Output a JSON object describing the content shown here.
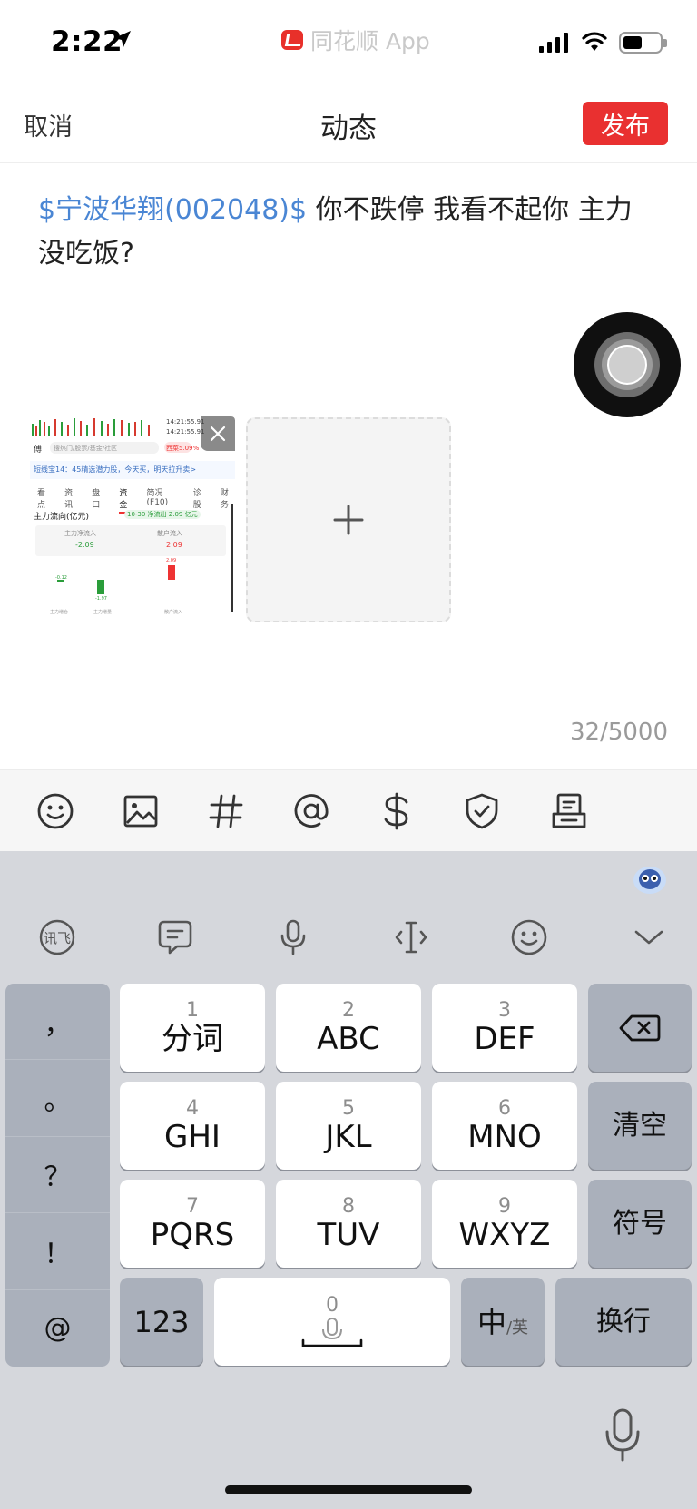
{
  "status_bar": {
    "time": "2:22",
    "app_name": "同花顺 App"
  },
  "nav": {
    "cancel_label": "取消",
    "title": "动态",
    "publish_label": "发布"
  },
  "post": {
    "stock_tag": "$宁波华翔(002048)$",
    "text": " 你不跌停 我看不起你 主力没吃饭?",
    "char_count": "32/5000"
  },
  "attachment": {
    "time_1": "14:21:55.91",
    "time_2": "14:21:55.91",
    "search_placeholder": "搜热门/股票/基金/社区",
    "tag_red": "西菜5.09%",
    "banner": "短线宝14：45精选潜力股，今天买，明天拉升卖>",
    "tabs": [
      "看点",
      "资讯",
      "盘口",
      "资金",
      "简况(F10)",
      "诊股",
      "财务"
    ],
    "active_tab": "资金",
    "flow_title": "主力流向(亿元)",
    "flow_chip": "10-30 净流出 2.09 亿元",
    "main_in_label": "主力净流入",
    "main_in_value": "-2.09",
    "retail_label": "散户流入",
    "retail_value": "2.09",
    "bar_labels": [
      "主力增仓",
      "主力增量",
      "散户流入"
    ],
    "bar_values": [
      "-0.12",
      "-1.97",
      "2.09"
    ]
  },
  "keyboard": {
    "punctuation": [
      "，",
      "。",
      "？",
      "！",
      "@"
    ],
    "keys": [
      {
        "num": "1",
        "label": "分词"
      },
      {
        "num": "2",
        "label": "ABC"
      },
      {
        "num": "3",
        "label": "DEF"
      },
      {
        "num": "4",
        "label": "GHI"
      },
      {
        "num": "5",
        "label": "JKL"
      },
      {
        "num": "6",
        "label": "MNO"
      },
      {
        "num": "7",
        "label": "PQRS"
      },
      {
        "num": "8",
        "label": "TUV"
      },
      {
        "num": "9",
        "label": "WXYZ"
      }
    ],
    "clear_label": "清空",
    "symbols_label": "符号",
    "num_mode_label": "123",
    "space_num": "0",
    "lang_main": "中",
    "lang_sub": "/英",
    "enter_label": "换行"
  }
}
